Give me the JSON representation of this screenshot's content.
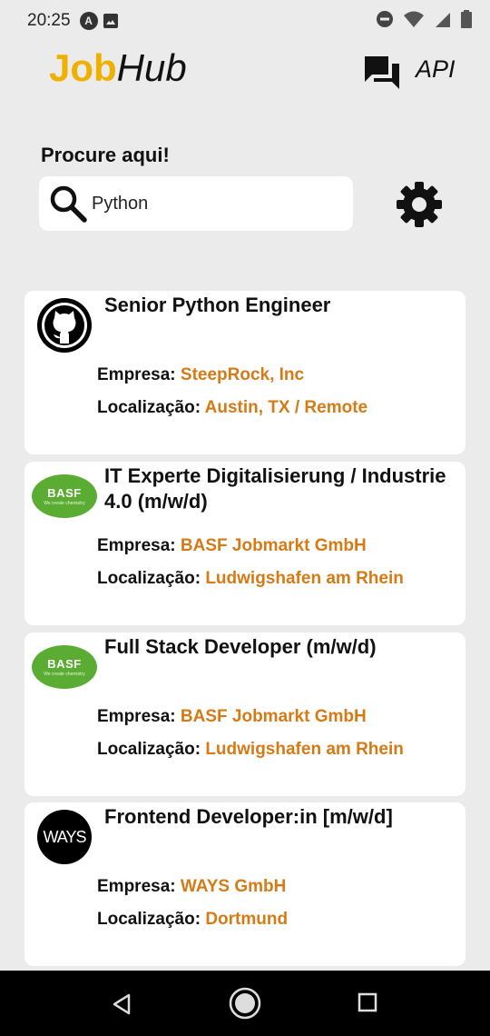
{
  "status_bar": {
    "time": "20:25",
    "left_icons": [
      "a-badge-icon",
      "image-icon"
    ],
    "right_icons": [
      "do-not-disturb-icon",
      "wifi-icon",
      "signal-icon",
      "battery-icon"
    ]
  },
  "header": {
    "logo_part1": "Job",
    "logo_part2": "Hub",
    "api_label": "API",
    "chat_icon": "forum-icon"
  },
  "search": {
    "title": "Procure aqui!",
    "value": "Python",
    "icon": "search-icon",
    "settings_icon": "gear-icon"
  },
  "jobs": [
    {
      "title": "Senior Python Engineer",
      "company_label": "Empresa:",
      "company": "SteepRock, Inc",
      "location_label": "Localização:",
      "location": "Austin, TX / Remote",
      "logo": "github-logo"
    },
    {
      "title": "IT Experte Digitalisierung / Industrie 4.0 (m/w/d)",
      "company_label": "Empresa:",
      "company": "BASF Jobmarkt GmbH",
      "location_label": "Localização:",
      "location": "Ludwigshafen am Rhein",
      "logo": "basf-logo",
      "logo_text": "BASF",
      "logo_subtext": "We create chemistry"
    },
    {
      "title": "Full Stack Developer (m/w/d)",
      "company_label": "Empresa:",
      "company": "BASF Jobmarkt GmbH",
      "location_label": "Localização:",
      "location": "Ludwigshafen am Rhein",
      "logo": "basf-logo",
      "logo_text": "BASF",
      "logo_subtext": "We create chemistry"
    },
    {
      "title": "Frontend Developer:in [m/w/d]",
      "company_label": "Empresa:",
      "company": "WAYS GmbH",
      "location_label": "Localização:",
      "location": "Dortmund",
      "logo": "ways-logo",
      "logo_text": "WAYS"
    }
  ],
  "colors": {
    "background": "#ebebeb",
    "logo_accent": "#f0b000",
    "value_accent": "#d67a16",
    "basf_green": "#5aad32"
  },
  "nav_bar": {
    "icons": [
      "back-icon",
      "home-icon",
      "recent-apps-icon"
    ]
  }
}
